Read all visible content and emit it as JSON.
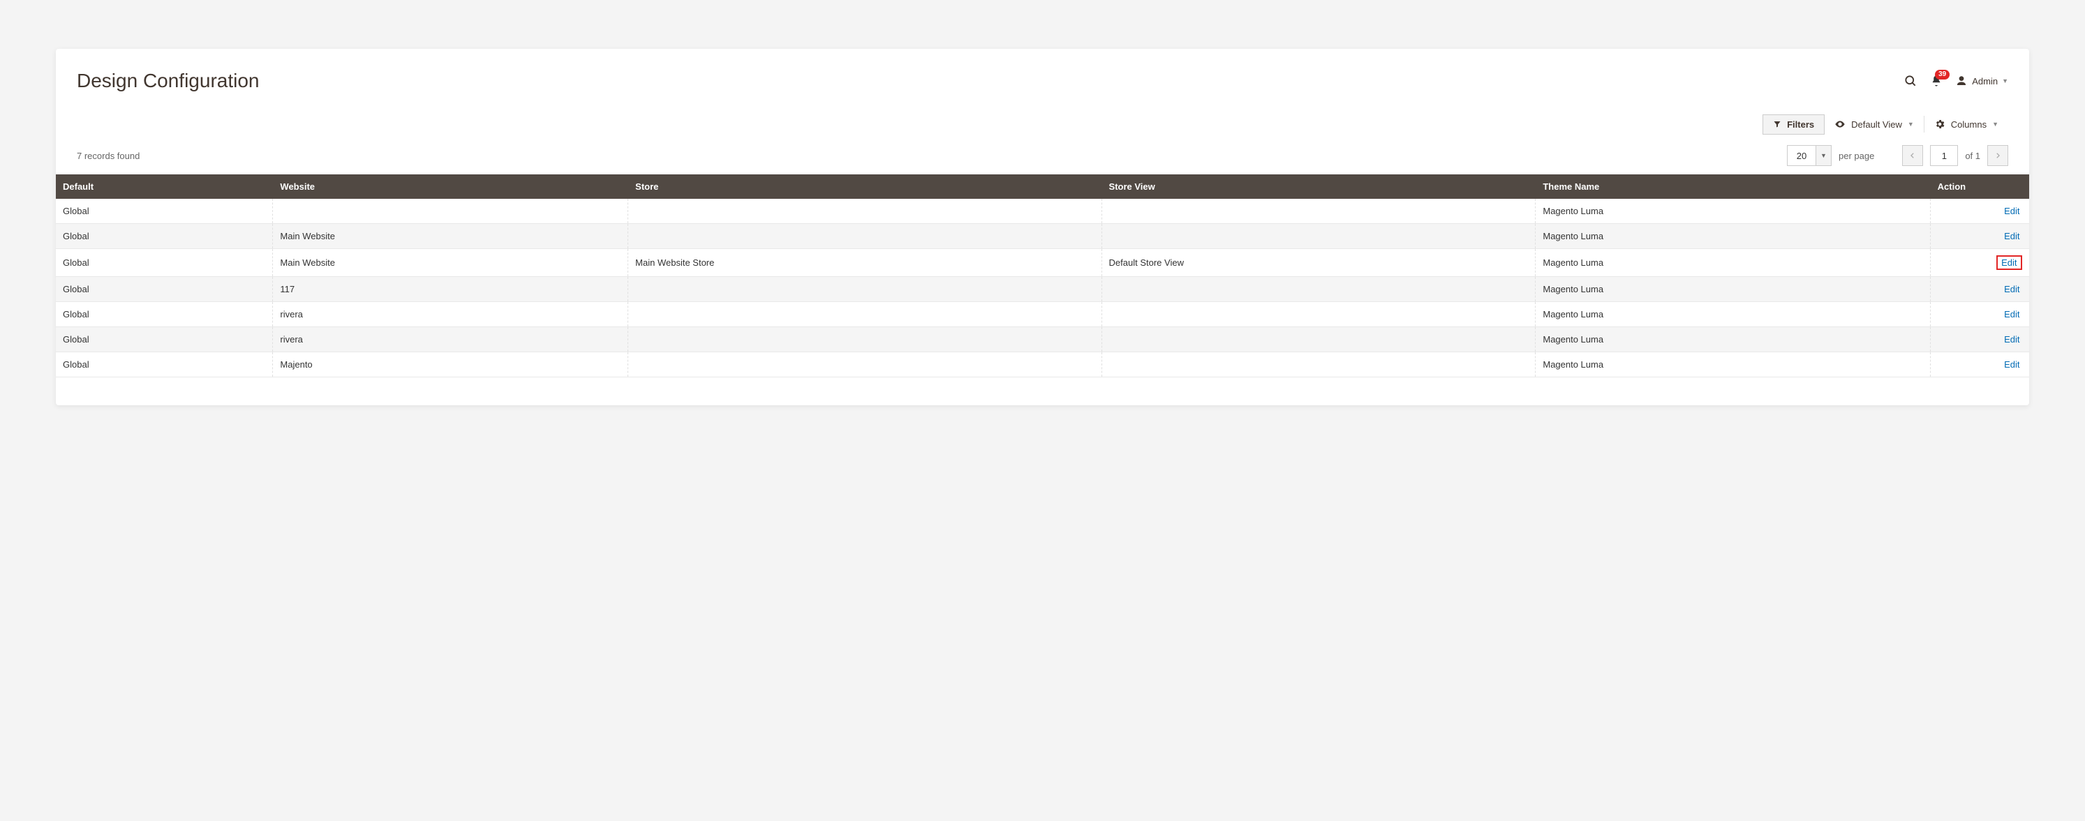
{
  "page": {
    "title": "Design Configuration"
  },
  "header": {
    "notification_count": "39",
    "admin_label": "Admin"
  },
  "toolbar": {
    "filters_label": "Filters",
    "default_view_label": "Default View",
    "columns_label": "Columns"
  },
  "list": {
    "records_found": "7 records found",
    "per_page_value": "20",
    "per_page_label": "per page",
    "page_current": "1",
    "page_of_label": "of 1"
  },
  "columns": {
    "default": "Default",
    "website": "Website",
    "store": "Store",
    "store_view": "Store View",
    "theme_name": "Theme Name",
    "action": "Action"
  },
  "action_label": "Edit",
  "rows": [
    {
      "default": "Global",
      "website": "",
      "store": "",
      "store_view": "",
      "theme": "Magento Luma",
      "highlight": false
    },
    {
      "default": "Global",
      "website": "Main Website",
      "store": "",
      "store_view": "",
      "theme": "Magento Luma",
      "highlight": false
    },
    {
      "default": "Global",
      "website": "Main Website",
      "store": "Main Website Store",
      "store_view": "Default Store View",
      "theme": "Magento Luma",
      "highlight": true
    },
    {
      "default": "Global",
      "website": "117",
      "store": "",
      "store_view": "",
      "theme": "Magento Luma",
      "highlight": false
    },
    {
      "default": "Global",
      "website": "rivera",
      "store": "",
      "store_view": "",
      "theme": "Magento Luma",
      "highlight": false
    },
    {
      "default": "Global",
      "website": "rivera",
      "store": "",
      "store_view": "",
      "theme": "Magento Luma",
      "highlight": false
    },
    {
      "default": "Global",
      "website": "Majento",
      "store": "",
      "store_view": "",
      "theme": "Magento Luma",
      "highlight": false
    }
  ]
}
